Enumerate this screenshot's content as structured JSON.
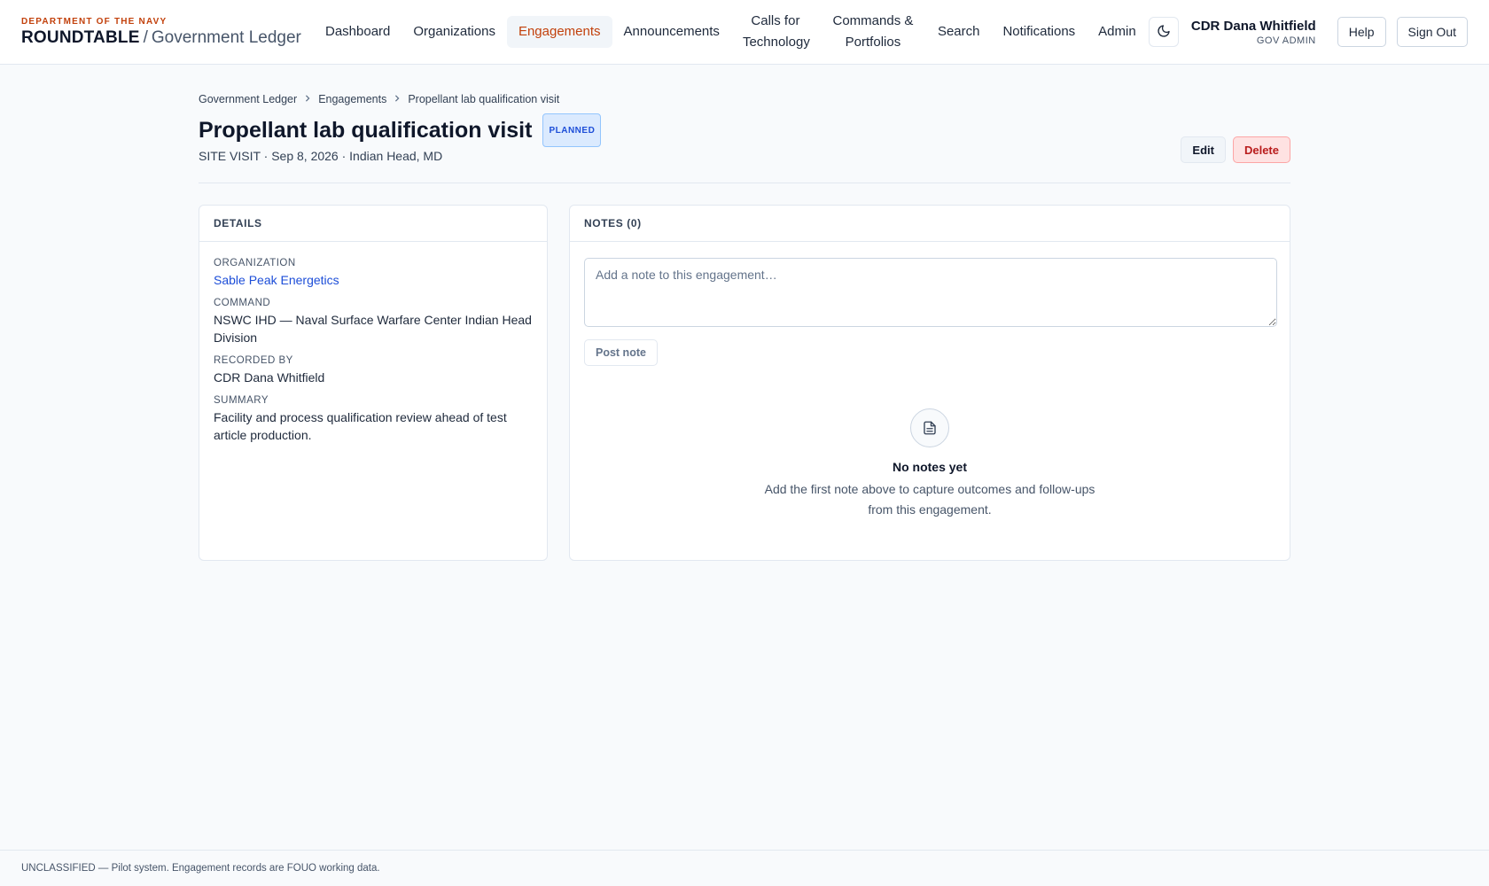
{
  "brand": {
    "department": "DEPARTMENT OF THE NAVY",
    "name": "ROUNDTABLE",
    "separator": "/",
    "subtitle": "Government Ledger"
  },
  "nav": {
    "items": [
      {
        "label": "Dashboard"
      },
      {
        "label": "Organizations"
      },
      {
        "label": "Engagements",
        "active": true
      },
      {
        "label": "Announcements"
      },
      {
        "label": "Calls for Technology"
      },
      {
        "label": "Commands & Portfolios"
      },
      {
        "label": "Search"
      },
      {
        "label": "Notifications"
      },
      {
        "label": "Admin"
      }
    ]
  },
  "header": {
    "theme_icon": "moon-icon",
    "user_name": "CDR Dana Whitfield",
    "user_role": "GOV ADMIN",
    "help_label": "Help",
    "signout_label": "Sign Out"
  },
  "breadcrumb": [
    "Government Ledger",
    "Engagements",
    "Propellant lab qualification visit"
  ],
  "page": {
    "title": "Propellant lab qualification visit",
    "status": "PLANNED",
    "subtitle": "SITE VISIT · Sep 8, 2026 · Indian Head, MD",
    "edit_label": "Edit",
    "delete_label": "Delete"
  },
  "details": {
    "heading": "DETAILS",
    "organization_label": "ORGANIZATION",
    "organization": "Sable Peak Energetics",
    "command_label": "COMMAND",
    "command": "NSWC IHD — Naval Surface Warfare Center Indian Head Division",
    "recorded_by_label": "RECORDED BY",
    "recorded_by": "CDR Dana Whitfield",
    "summary_label": "SUMMARY",
    "summary": "Facility and process qualification review ahead of test article production."
  },
  "notes": {
    "heading": "NOTES (0)",
    "placeholder": "Add a note to this engagement…",
    "value": "",
    "post_label": "Post note",
    "empty_icon": "document-icon",
    "empty_title": "No notes yet",
    "empty_text": "Add the first note above to capture outcomes and follow-ups from this engagement."
  },
  "footer": {
    "text": "UNCLASSIFIED — Pilot system. Engagement records are FOUO working data."
  },
  "colors": {
    "accent": "#c2410c",
    "link": "#1d4ed8",
    "danger": "#b91c1c",
    "badge": "#dbeafe"
  }
}
